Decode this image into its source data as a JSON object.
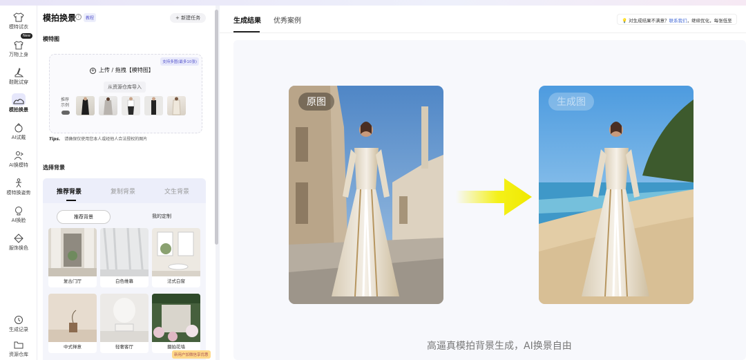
{
  "nav": {
    "items": [
      {
        "label": "模特试衣",
        "icon": "shirt-icon"
      },
      {
        "label": "万物上身",
        "icon": "tshirt-plus-icon",
        "badge": "New"
      },
      {
        "label": "鞋靴试穿",
        "icon": "shoe-icon"
      },
      {
        "label": "模拍换景",
        "icon": "landscape-icon",
        "active": true
      },
      {
        "label": "AI试戴",
        "icon": "accessory-icon"
      },
      {
        "label": "AI换模特",
        "icon": "swap-person-icon"
      },
      {
        "label": "模特换姿势",
        "icon": "pose-icon"
      },
      {
        "label": "AI换脸",
        "icon": "face-icon"
      },
      {
        "label": "服饰换色",
        "icon": "palette-icon"
      }
    ],
    "bottom": [
      {
        "label": "生成记录",
        "icon": "clock-icon"
      },
      {
        "label": "资源仓库",
        "icon": "folder-icon"
      }
    ]
  },
  "panel": {
    "title": "模拍换景",
    "tutorial": "教程",
    "new_task": "+ 新建任务",
    "model_section": "模特图",
    "upload": {
      "multi_hint": "支持多图(最多10张)",
      "upload_label": "上传 / 拖拽【模特图】",
      "import_label": "从资源仓库导入",
      "sample_label": "推荐示例"
    },
    "tips_prefix": "Tips.",
    "tips_text": "请确保仅使用您本人或经他人合法授权的图片",
    "bg_section": "选择背景",
    "bg_tabs": [
      "推荐背景",
      "复制背景",
      "文生背景"
    ],
    "bg_subtabs": [
      "推荐背景",
      "我的定制"
    ],
    "bg_cards": [
      "复古门厅",
      "白色帷幕",
      "法式白窗",
      "中式禅意",
      "轻奢客厅",
      "摄拍花墙"
    ],
    "bottom_chip": "新用户加微信享优惠"
  },
  "main": {
    "tabs": [
      "生成结果",
      "优秀案例"
    ],
    "hint_text": "对生成结果不满意？",
    "hint_link": "联系我们",
    "hint_tail": "，继续优化，每张低至",
    "original_label": "原图",
    "generated_label": "生成图",
    "caption": "高逼真模拍背景生成，AI换景自由"
  },
  "colors": {
    "accent": "#5a5ad0",
    "arrow": "#f4f000"
  }
}
